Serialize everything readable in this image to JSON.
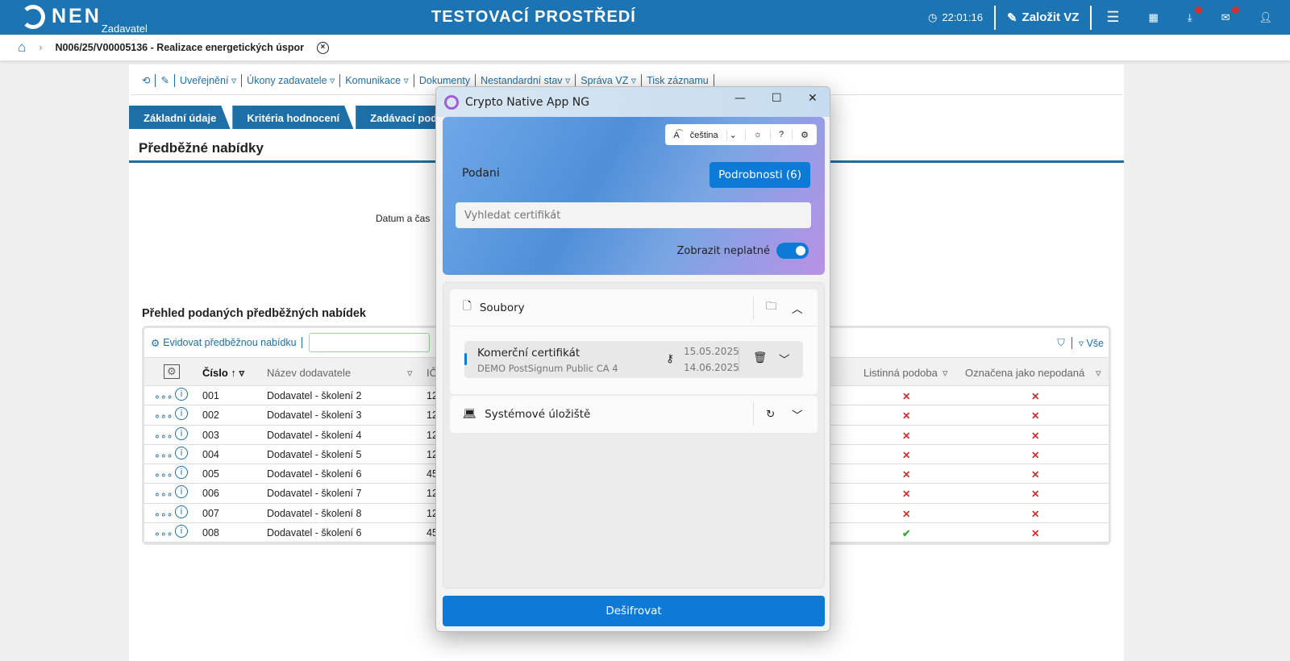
{
  "header": {
    "logo": "NEN",
    "logo_sub": "Zadavatel",
    "env": "TESTOVACÍ PROSTŘEDÍ",
    "time": "22:01:16",
    "create": "Založit VZ"
  },
  "breadcrumb": {
    "title": "N006/25/V00005136 - Realizace energetických úspor"
  },
  "toolbar": [
    "Uveřejnění ▿",
    "Úkony zadavatele ▿",
    "Komunikace ▿",
    "Dokumenty",
    "Nestandardní stav ▿",
    "Správa VZ ▿",
    "Tisk záznamu"
  ],
  "tabs": [
    "Základní údaje",
    "Kritéria hodnocení",
    "Zadávací pod"
  ],
  "page_title": "Předběžné nabídky",
  "datum_label": "Datum a čas",
  "grid": {
    "title": "Přehled podaných předběžných nabídek",
    "add": "Evidovat předběžnou nabídku",
    "filter_all": "Vše",
    "columns": {
      "cislo": "Číslo",
      "nazev": "Název dodavatele",
      "ic": "IČ",
      "listinna": "Listinná podoba",
      "nepodana": "Označena jako nepodaná"
    },
    "rows": [
      {
        "cislo": "001",
        "nazev": "Dodavatel - školení 2",
        "ic": "12",
        "listinna": "✕",
        "nepodana": "✕"
      },
      {
        "cislo": "002",
        "nazev": "Dodavatel - školení 3",
        "ic": "12",
        "listinna": "✕",
        "nepodana": "✕"
      },
      {
        "cislo": "003",
        "nazev": "Dodavatel - školení 4",
        "ic": "12",
        "listinna": "✕",
        "nepodana": "✕"
      },
      {
        "cislo": "004",
        "nazev": "Dodavatel - školení 5",
        "ic": "12",
        "listinna": "✕",
        "nepodana": "✕"
      },
      {
        "cislo": "005",
        "nazev": "Dodavatel - školení 6",
        "ic": "45",
        "listinna": "✕",
        "nepodana": "✕"
      },
      {
        "cislo": "006",
        "nazev": "Dodavatel - školení 7",
        "ic": "12",
        "listinna": "✕",
        "nepodana": "✕"
      },
      {
        "cislo": "007",
        "nazev": "Dodavatel - školení 8",
        "ic": "12",
        "listinna": "✕",
        "nepodana": "✕"
      },
      {
        "cislo": "008",
        "nazev": "Dodavatel - školení 6",
        "ic": "45",
        "listinna": "✔",
        "nepodana": "✕"
      }
    ]
  },
  "dialog": {
    "title": "Crypto Native App NG",
    "language": "čeština",
    "podani": "Podani",
    "details": "Podrobnosti (6)",
    "search_placeholder": "Vyhledat certifikát",
    "show_invalid": "Zobrazit neplatné",
    "show_invalid_on": true,
    "files": "Soubory",
    "cert_name": "Komerční certifikát",
    "cert_issuer": "DEMO PostSignum Public CA 4",
    "valid_from": "15.05.2025",
    "valid_to": "14.06.2025",
    "system_store": "Systémové úložiště",
    "decrypt": "Dešifrovat"
  }
}
